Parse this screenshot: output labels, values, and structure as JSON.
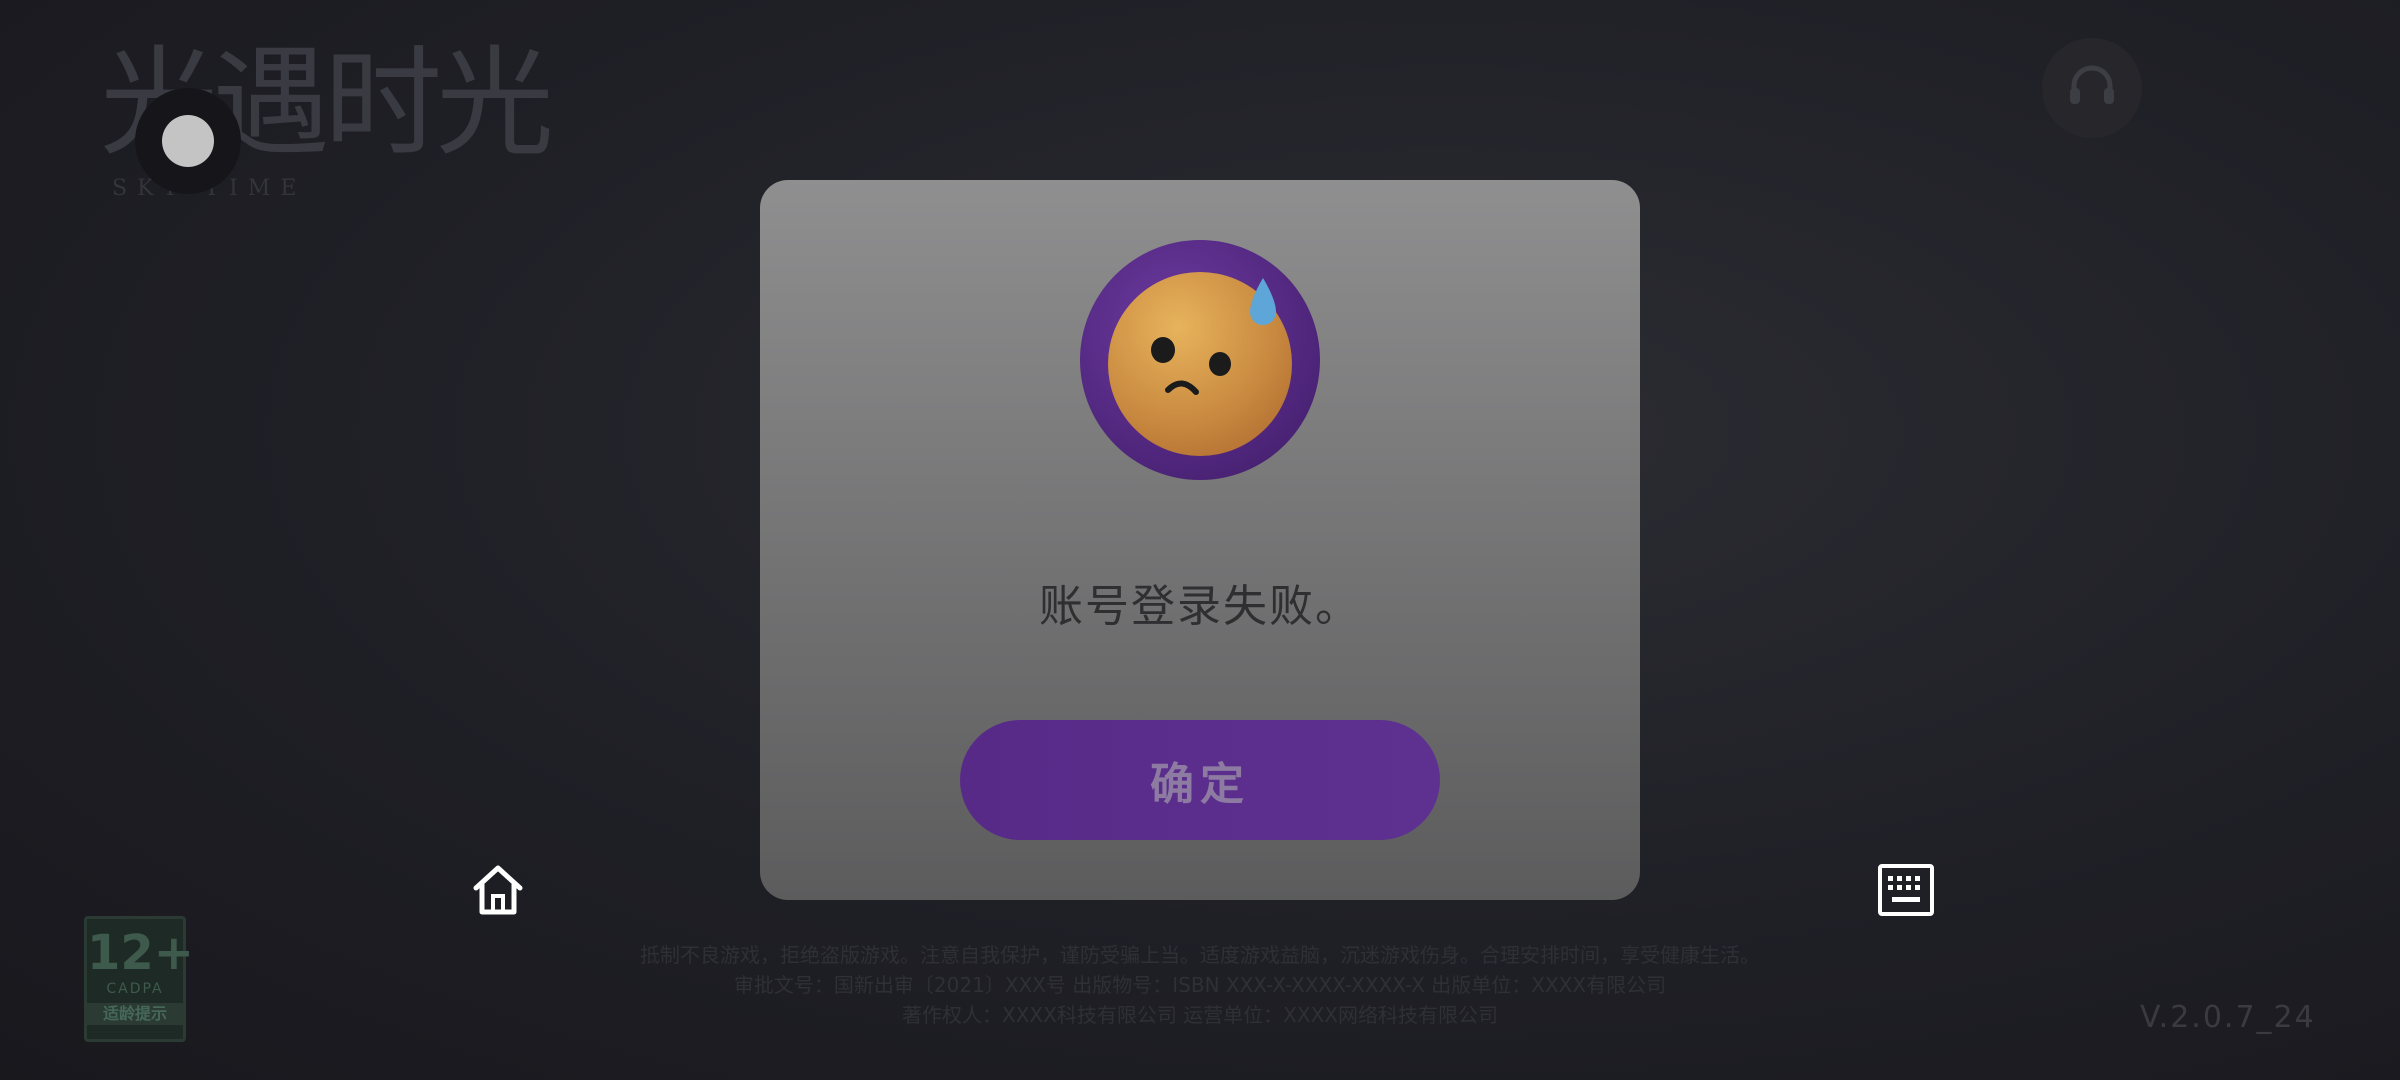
{
  "game": {
    "logo_text": "光遇时光",
    "logo_subtitle": "SKY TIME"
  },
  "rating": {
    "age": "12+",
    "cadpa": "CADPA",
    "tip": "适龄提示"
  },
  "footer": {
    "notice_lines": [
      "抵制不良游戏，拒绝盗版游戏。注意自我保护，谨防受骗上当。适度游戏益脑，沉迷游戏伤身。合理安排时间，享受健康生活。",
      "审批文号：国新出审〔2021〕XXX号  出版物号：ISBN XXX-X-XXXX-XXXX-X  出版单位：XXXX有限公司",
      "著作权人：XXXX科技有限公司  运营单位：XXXX网络科技有限公司"
    ],
    "version": "V.2.0.7_24"
  },
  "dialog": {
    "message": "账号登录失败。",
    "confirm_label": "确定",
    "avatar_icon": "sweat-sad-face-icon"
  },
  "nav": {
    "home_icon": "home-icon",
    "keyboard_icon": "keyboard-icon",
    "support_icon": "headset-icon"
  },
  "colors": {
    "dialog_bg": "#8f8f90",
    "button": "#582a88",
    "ring": "#4c2478"
  }
}
